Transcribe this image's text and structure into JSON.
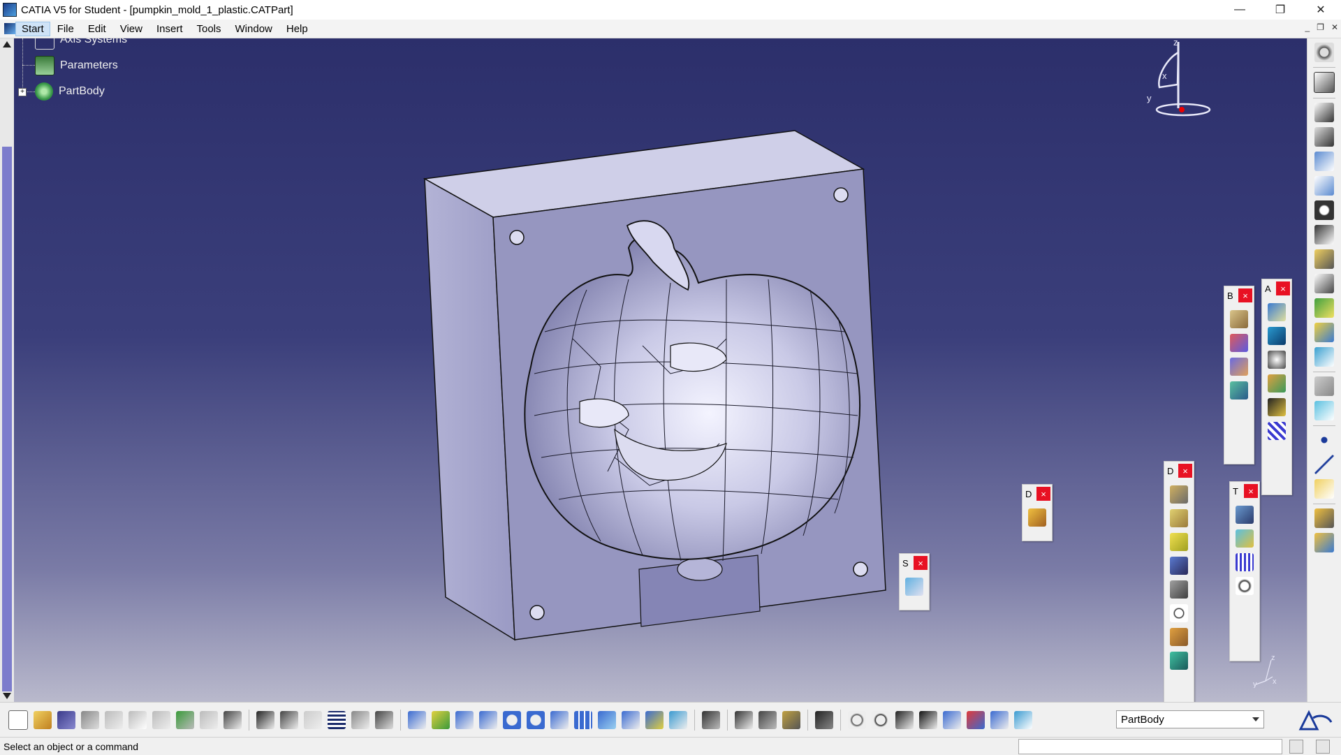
{
  "window": {
    "title": "CATIA V5 for Student - [pumpkin_mold_1_plastic.CATPart]",
    "controls": {
      "minimize": "—",
      "restore": "❐",
      "close": "✕"
    }
  },
  "menu": {
    "items": [
      "Start",
      "File",
      "Edit",
      "View",
      "Insert",
      "Tools",
      "Window",
      "Help"
    ],
    "doc_controls": {
      "minimize": "_",
      "restore": "❐",
      "close": "✕"
    }
  },
  "tree": {
    "items": [
      {
        "label": "Axis Systems",
        "icon": "axis-systems-icon"
      },
      {
        "label": "Parameters",
        "icon": "parameters-icon"
      },
      {
        "label": "PartBody",
        "icon": "partbody-gear-icon"
      }
    ]
  },
  "compass": {
    "labels": {
      "z": "z",
      "x": "x",
      "y": "y"
    }
  },
  "axis_mini": {
    "z": "z",
    "y": "y",
    "x": "x"
  },
  "floating_toolbars": [
    {
      "label": "B",
      "close": "×",
      "icons": [
        "assemble-icon",
        "add-body-icon",
        "intersect-icon",
        "remove-lump-icon"
      ]
    },
    {
      "label": "A",
      "close": "×",
      "icons": [
        "apply-material-icon",
        "surface-icon",
        "sphere-icon",
        "layer-icon",
        "measure-icon",
        "pattern-icon"
      ]
    },
    {
      "label": "D",
      "close": "×",
      "icons": [
        "draft-icon",
        "fillet-icon",
        "shell-icon",
        "thickness-icon",
        "thread-icon",
        "remove-face-icon",
        "replace-icon",
        "box-icon"
      ]
    },
    {
      "label": "T",
      "close": "×",
      "icons": [
        "translate-icon",
        "mirror-icon",
        "pattern-grid-icon",
        "scale-icon"
      ]
    },
    {
      "label": "D",
      "close": "×",
      "icons": [
        "hand-icon"
      ]
    },
    {
      "label": "S",
      "close": "×",
      "icons": [
        "eraser-icon"
      ]
    }
  ],
  "status": {
    "message": "Select an object or a command",
    "current_body": "PartBody"
  },
  "colors": {
    "viewport_top": "#2c2f6b",
    "viewport_bottom": "#b9b9cc",
    "part_face": "#9a9ac4",
    "close_button": "#e81123",
    "scroll_thumb": "#7c7ccc"
  }
}
